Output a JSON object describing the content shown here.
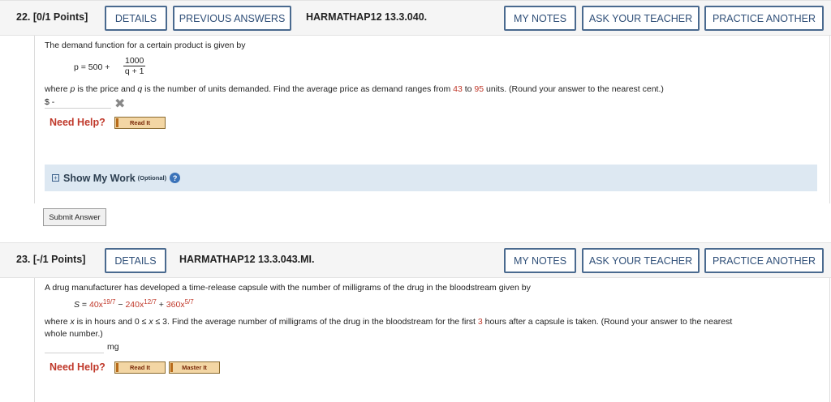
{
  "q22": {
    "number": "22.",
    "points": "[0/1 Points]",
    "details_label": "DETAILS",
    "previous_answers_label": "PREVIOUS ANSWERS",
    "code": "HARMATHAP12 13.3.040.",
    "my_notes_label": "MY NOTES",
    "ask_teacher_label": "ASK YOUR TEACHER",
    "practice_another_label": "PRACTICE ANOTHER",
    "intro": "The demand function for a certain product is given by",
    "eq_lhs": "p = 500 +",
    "eq_num": "1000",
    "eq_den": "q + 1",
    "where_1": "where ",
    "where_p": "p",
    "where_2": " is the price and ",
    "where_q": "q",
    "where_3": " is the number of units demanded. Find the average price as demand ranges from ",
    "where_43": "43",
    "where_4": " to ",
    "where_95": "95",
    "where_5": " units. (Round your answer to the nearest cent.)",
    "answer_prefix": "$ -",
    "need_help": "Need Help?",
    "read_it": "Read It",
    "show_my_work": "Show My Work",
    "optional": "(Optional)",
    "submit": "Submit Answer"
  },
  "q23": {
    "number": "23.",
    "points": "[-/1 Points]",
    "details_label": "DETAILS",
    "code": "HARMATHAP12 13.3.043.MI.",
    "my_notes_label": "MY NOTES",
    "ask_teacher_label": "ASK YOUR TEACHER",
    "practice_another_label": "PRACTICE ANOTHER",
    "intro": "A drug manufacturer has developed a time-release capsule with the number of milligrams of the drug in the bloodstream given by",
    "eq_s": "S",
    "eq_eq": " = ",
    "eq_t1": "40x",
    "eq_e1": "19/7",
    "eq_minus": " − ",
    "eq_t2": "240x",
    "eq_e2": "12/7",
    "eq_plus": " + ",
    "eq_t3": "360x",
    "eq_e3": "5/7",
    "where_1": "where ",
    "where_x": "x",
    "where_2": " is in hours and 0 ≤ ",
    "where_x2": "x",
    "where_3": " ≤ 3. Find the average number of milligrams of the drug in the bloodstream for the first ",
    "where_3h": "3",
    "where_4": " hours after a capsule is taken. (Round your answer to the nearest",
    "where_line2": "whole number.)",
    "unit": "mg",
    "need_help": "Need Help?",
    "read_it": "Read It",
    "master_it": "Master It"
  }
}
